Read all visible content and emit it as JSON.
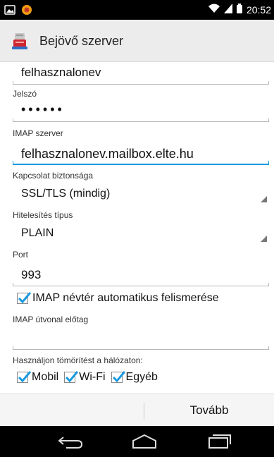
{
  "status_bar": {
    "time": "20:52",
    "icons": [
      "image-notification-icon",
      "app-notification-icon",
      "wifi-icon",
      "signal-icon",
      "battery-icon"
    ]
  },
  "action_bar": {
    "title": "Bejövő szerver",
    "icon": "server-app-icon"
  },
  "form": {
    "username_value": "felhasznalonev",
    "password_label": "Jelszó",
    "password_value": "••••••",
    "imap_server_label": "IMAP szerver",
    "imap_server_value": "felhasznalonev.mailbox.elte.hu",
    "security_label": "Kapcsolat biztonsága",
    "security_value": "SSL/TLS (mindig)",
    "auth_label": "Hitelesítés típus",
    "auth_value": "PLAIN",
    "port_label": "Port",
    "port_value": "993",
    "namespace_checkbox_label": "IMAP névtér automatikus felismerése",
    "namespace_checked": true,
    "path_prefix_label": "IMAP útvonal előtag",
    "path_prefix_value": "",
    "compression_label": "Használjon tömörítést a hálózaton:",
    "compression_options": [
      {
        "label": "Mobil",
        "checked": true
      },
      {
        "label": "Wi-Fi",
        "checked": true
      },
      {
        "label": "Egyéb",
        "checked": true
      }
    ]
  },
  "bottom_bar": {
    "next_label": "Tovább"
  },
  "colors": {
    "accent": "#1a9ae0",
    "checkbox": "#1a9ae0",
    "status_bar": "#000000",
    "action_bar": "#ececec"
  }
}
